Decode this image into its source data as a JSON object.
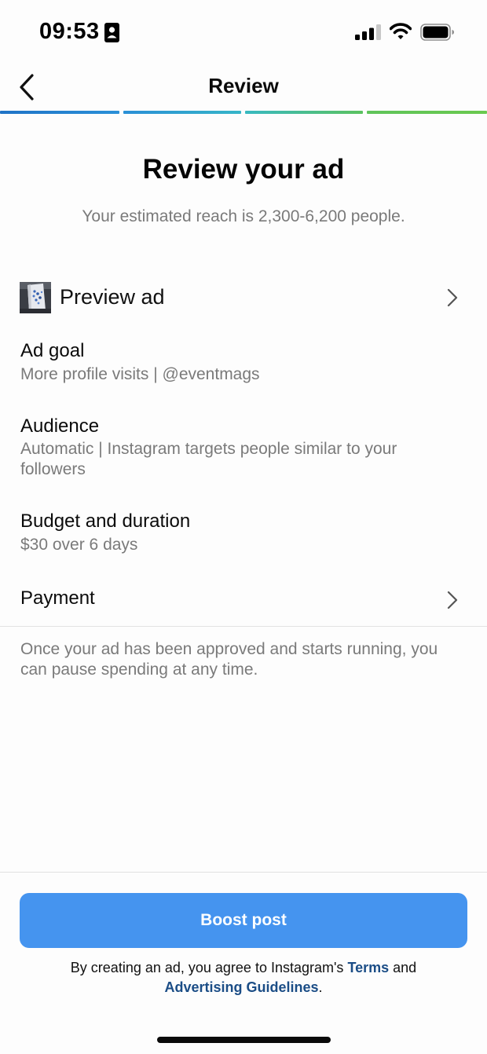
{
  "status_bar": {
    "time": "09:53",
    "icons": [
      "id-card-icon",
      "cellular-signal-icon",
      "wifi-icon",
      "battery-icon"
    ]
  },
  "nav": {
    "title": "Review",
    "back_icon": "chevron-left-icon"
  },
  "progress": {
    "steps_total": 4,
    "steps_completed": 4,
    "colors": [
      "#1f73c6",
      "#2a9bd4",
      "#3cb7b8",
      "#6ac94f"
    ]
  },
  "header": {
    "title": "Review your ad",
    "reach": "Your estimated reach is 2,300-6,200 people."
  },
  "rows": {
    "preview": {
      "label": "Preview ad",
      "icon": "chevron-right-icon"
    },
    "goal": {
      "title": "Ad goal",
      "value": "More profile visits | @eventmags"
    },
    "audience": {
      "title": "Audience",
      "value": "Automatic | Instagram targets people similar to your followers"
    },
    "budget": {
      "title": "Budget and duration",
      "value": "$30 over 6 days"
    },
    "payment": {
      "title": "Payment",
      "icon": "chevron-right-icon"
    }
  },
  "info": "Once your ad has been approved and starts running, you can pause spending at any time.",
  "cta": {
    "label": "Boost post",
    "color": "#4594ef"
  },
  "terms": {
    "prefix": "By creating an ad, you agree to Instagram's ",
    "terms_link": "Terms",
    "middle": " and",
    "guidelines_link": "Advertising Guidelines",
    "suffix": ".",
    "link_color": "#1b4d86"
  }
}
